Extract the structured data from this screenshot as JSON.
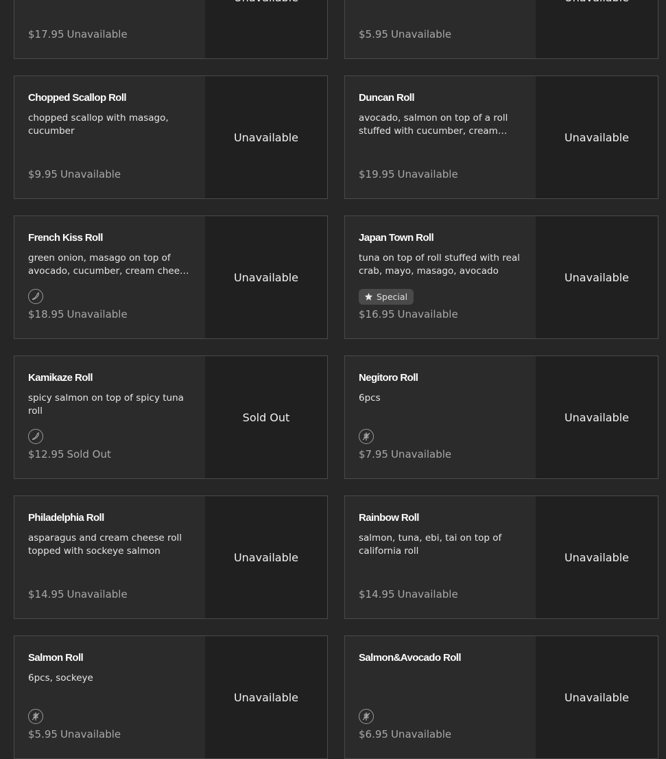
{
  "items": [
    {
      "name": "",
      "description": "",
      "price": "$17.95",
      "availability": "Unavailable",
      "status": "Unavailable",
      "icon": null,
      "special": null
    },
    {
      "name": "",
      "description": "",
      "price": "$5.95",
      "availability": "Unavailable",
      "status": "Unavailable",
      "icon": null,
      "special": null
    },
    {
      "name": "Chopped Scallop Roll",
      "description": "chopped scallop with masago, cucumber",
      "price": "$9.95",
      "availability": "Unavailable",
      "status": "Unavailable",
      "icon": null,
      "special": null
    },
    {
      "name": "Duncan Roll",
      "description": "avocado, salmon on top of a roll stuffed with cucumber, cream cheese",
      "price": "$19.95",
      "availability": "Unavailable",
      "status": "Unavailable",
      "icon": null,
      "special": null
    },
    {
      "name": "French Kiss Roll",
      "description": "green onion, masago on top of avocado, cucumber, cream cheese roll",
      "price": "$18.95",
      "availability": "Unavailable",
      "status": "Unavailable",
      "icon": "chili-pepper-icon",
      "special": null
    },
    {
      "name": "Japan Town Roll",
      "description": "tuna on top of roll stuffed with real crab, mayo, masago, avocado",
      "price": "$16.95",
      "availability": "Unavailable",
      "status": "Unavailable",
      "icon": null,
      "special": "Special"
    },
    {
      "name": "Kamikaze Roll",
      "description": "spicy salmon on top of spicy tuna roll",
      "price": "$12.95",
      "availability": "Sold Out",
      "status": "Sold Out",
      "icon": "chili-pepper-icon",
      "special": null
    },
    {
      "name": "Negitoro Roll",
      "description": "6pcs",
      "price": "$7.95",
      "availability": "Unavailable",
      "status": "Unavailable",
      "icon": "gluten-free-icon",
      "special": null
    },
    {
      "name": "Philadelphia Roll",
      "description": "asparagus and cream cheese roll topped with sockeye salmon",
      "price": "$14.95",
      "availability": "Unavailable",
      "status": "Unavailable",
      "icon": null,
      "special": null
    },
    {
      "name": "Rainbow Roll",
      "description": "salmon, tuna, ebi, tai on top of california roll",
      "price": "$14.95",
      "availability": "Unavailable",
      "status": "Unavailable",
      "icon": null,
      "special": null
    },
    {
      "name": "Salmon Roll",
      "description": "6pcs, sockeye",
      "price": "$5.95",
      "availability": "Unavailable",
      "status": "Unavailable",
      "icon": "gluten-free-icon",
      "special": null
    },
    {
      "name": "Salmon&Avocado Roll",
      "description": "",
      "price": "$6.95",
      "availability": "Unavailable",
      "status": "Unavailable",
      "icon": "gluten-free-icon",
      "special": null
    }
  ],
  "colors": {
    "background": "#262626",
    "card": "#2b2b2b",
    "status_panel": "#202020",
    "border": "#4a4a4a",
    "price_text": "#a8a8a8"
  }
}
